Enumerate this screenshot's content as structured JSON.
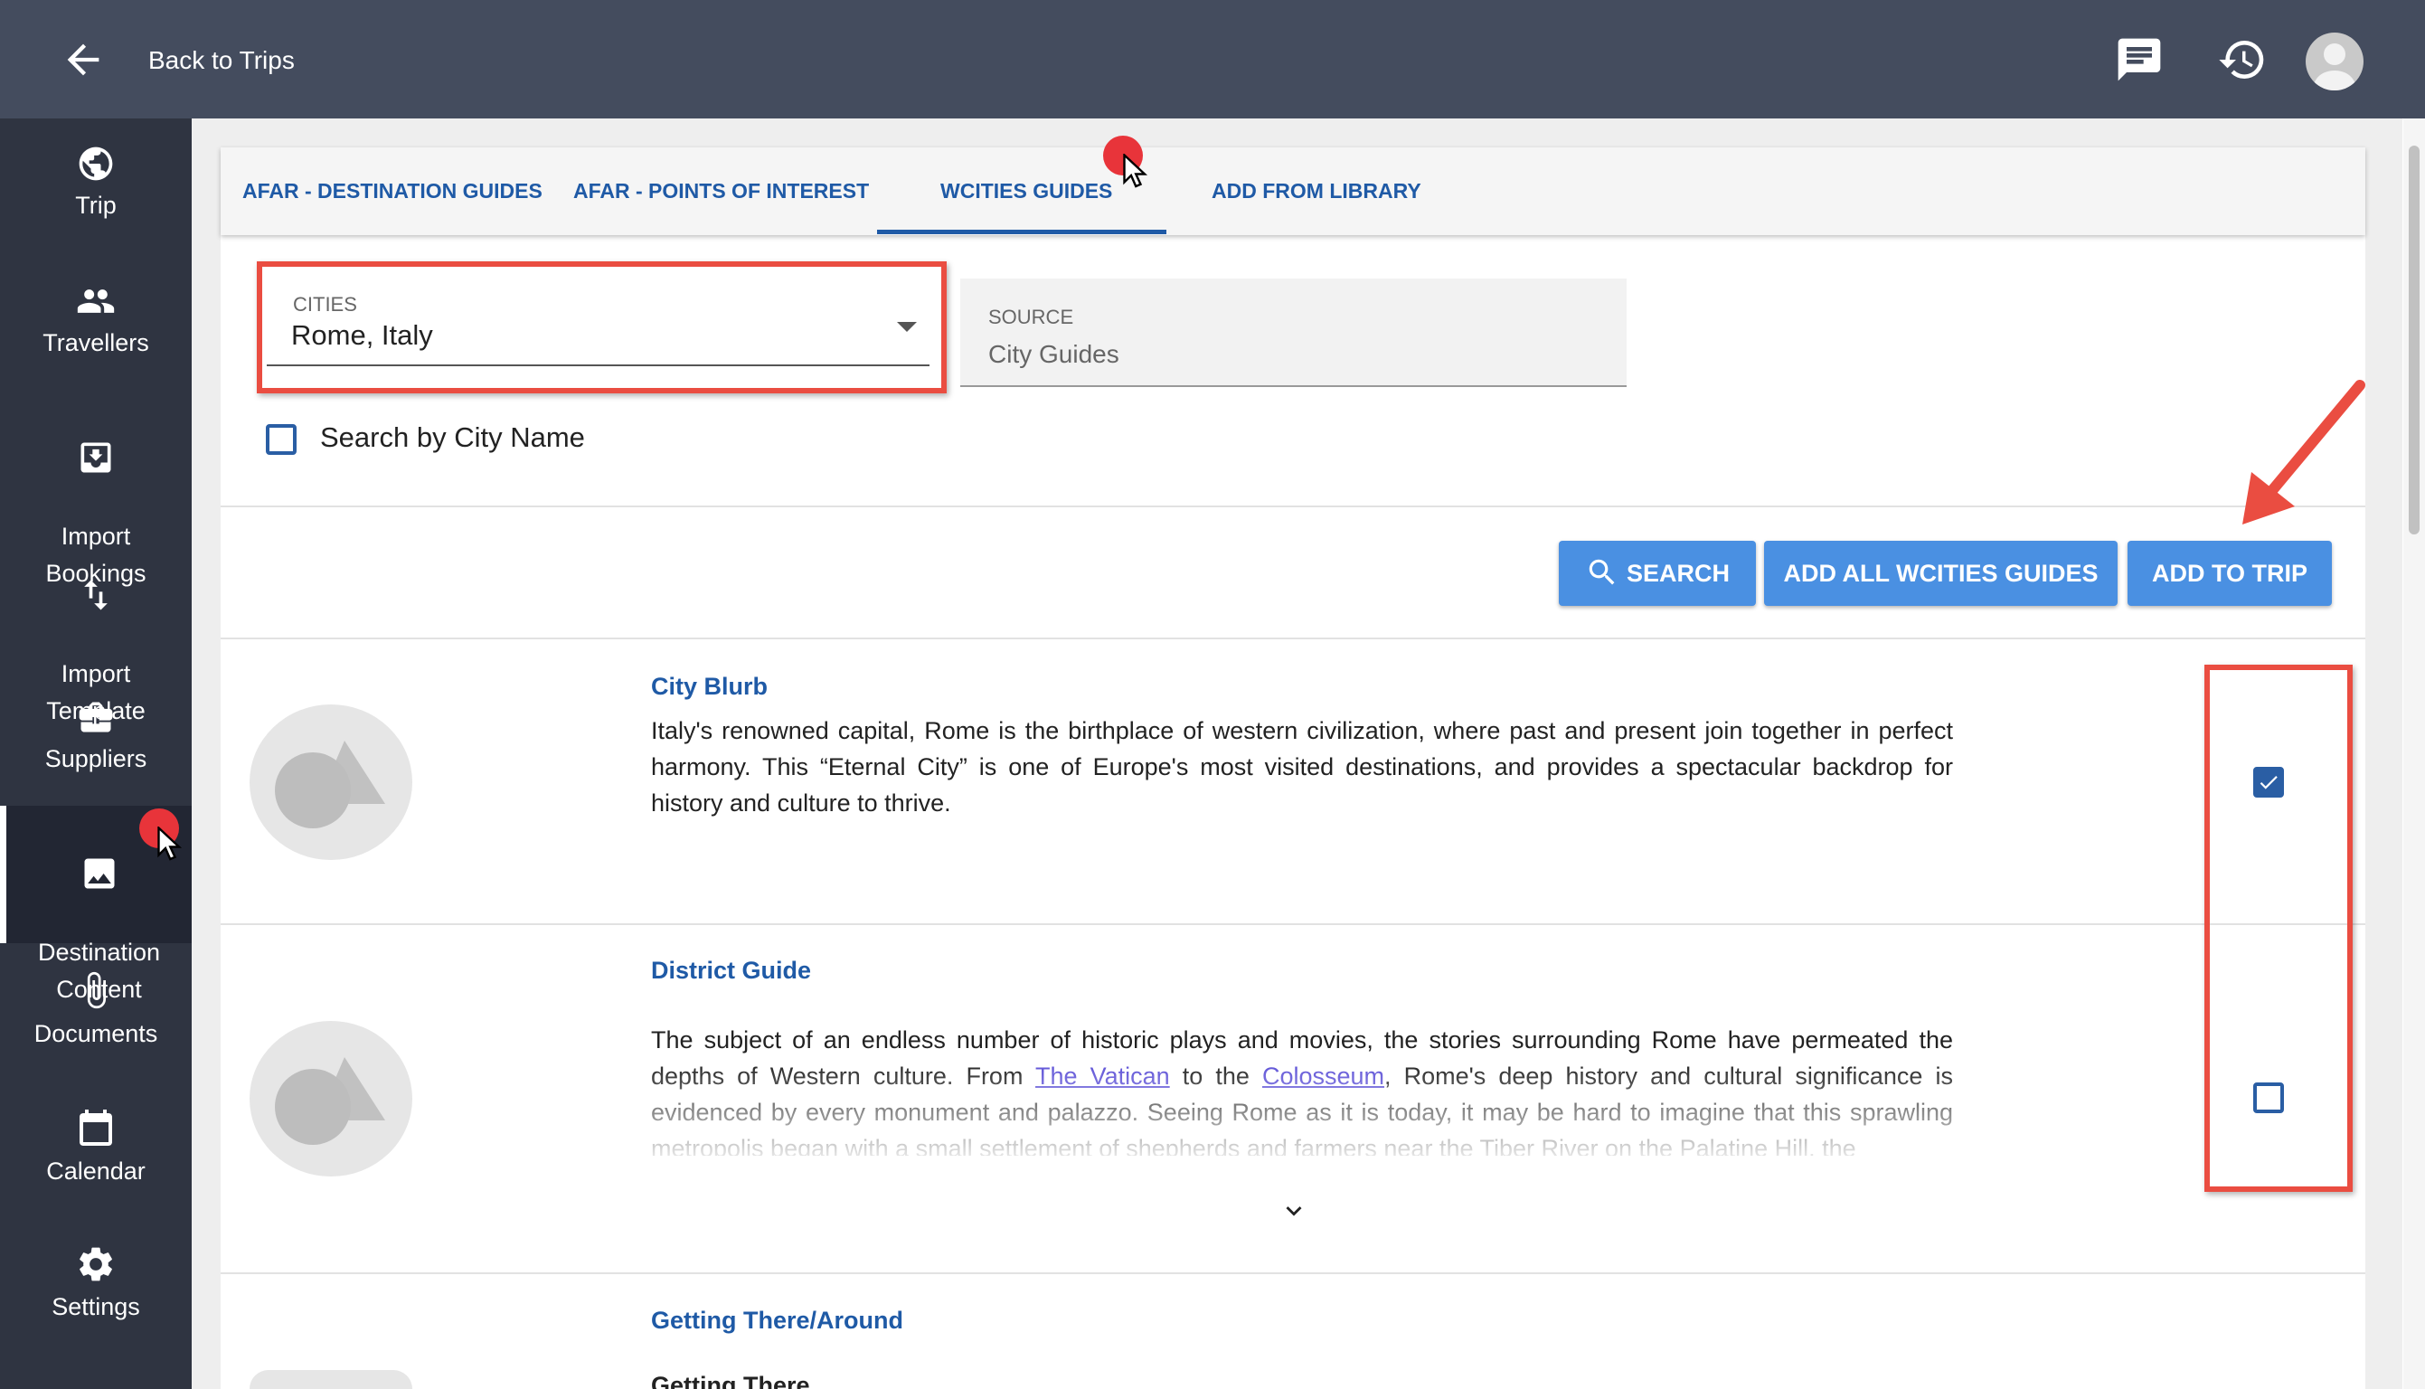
{
  "header": {
    "back_label": "Back to Trips"
  },
  "sidebar": {
    "items": [
      {
        "label": "Trip",
        "icon": "globe-icon"
      },
      {
        "label": "Travellers",
        "icon": "people-icon"
      },
      {
        "label": "Import\nBookings",
        "icon": "import-icon"
      },
      {
        "label": "Import\nTemplate",
        "icon": "swap-vertical-icon"
      },
      {
        "label": "Suppliers",
        "icon": "briefcase-icon"
      },
      {
        "label": "Destination\nContent",
        "icon": "image-icon"
      },
      {
        "label": "Documents",
        "icon": "paperclip-icon"
      },
      {
        "label": "Calendar",
        "icon": "calendar-icon"
      },
      {
        "label": "Settings",
        "icon": "gear-icon"
      }
    ]
  },
  "tabs": [
    {
      "label": "AFAR - DESTINATION GUIDES"
    },
    {
      "label": "AFAR - POINTS OF INTEREST"
    },
    {
      "label": "WCITIES GUIDES"
    },
    {
      "label": "ADD FROM LIBRARY"
    }
  ],
  "filters": {
    "cities_label": "CITIES",
    "cities_value": "Rome, Italy",
    "source_label": "SOURCE",
    "source_value": "City Guides",
    "search_by_city_label": "Search by City Name",
    "search_by_city_checked": false
  },
  "actions": {
    "search_label": "SEARCH",
    "add_all_label": "ADD ALL WCITIES GUIDES",
    "add_to_trip_label": "ADD TO TRIP"
  },
  "guides": [
    {
      "title": "City Blurb",
      "text": "Italy's renowned capital, Rome is the birthplace of western civilization, where past and present join together in perfect harmony. This “Eternal City” is one of Europe's most visited destinations, and provides a spectacular backdrop for history and culture to thrive.",
      "checked": true
    },
    {
      "title": "District Guide",
      "text_before": "The subject of an endless number of historic plays and movies, the stories surrounding Rome have permeated the depths of Western culture. From ",
      "link1": "The Vatican",
      "text_mid": " to the ",
      "link2": "Colosseum",
      "text_after": ", Rome's deep history and cultural significance is evidenced by every monument and palazzo. Seeing Rome as it is today, it may be hard to imagine that this sprawling metropolis began with a small settlement of shepherds and farmers near the Tiber River on the Palatine Hill, the",
      "checked": false
    },
    {
      "title": "Getting There/Around",
      "subtitle": "Getting There"
    }
  ],
  "colors": {
    "topbar": "#444c5e",
    "sidebar": "#2f3441",
    "accent": "#1f5aa6",
    "button": "#4a90e2",
    "annotation": "#ea4d41"
  }
}
